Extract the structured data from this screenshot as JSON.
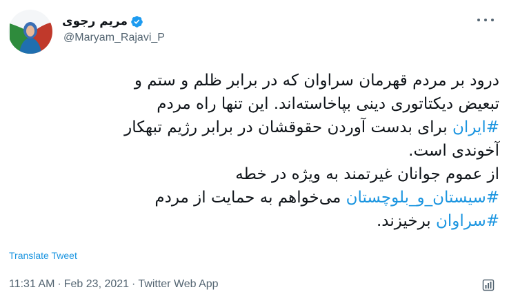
{
  "user": {
    "display_name": "مریم رجوی",
    "handle": "@Maryam_Rajavi_P",
    "verified_icon": "verified-badge-icon",
    "avatar_icon": "avatar"
  },
  "tweet": {
    "lines": [
      [
        {
          "text": "درود بر مردم قهرمان سراوان که در برابر ظلم و ستم و",
          "type": "text"
        }
      ],
      [
        {
          "text": "تبعیض دیکتاتوری دینی بپاخاسته‌اند. این تنها راه مردم",
          "type": "text"
        }
      ],
      [
        {
          "text": "#ایران",
          "type": "hashtag"
        },
        {
          "text": " برای بدست آوردن حقوقشان در برابر رژیم تبهکار",
          "type": "text"
        }
      ],
      [
        {
          "text": "آخوندی است.",
          "type": "text"
        }
      ],
      [
        {
          "text": "از عموم جوانان غیرتمند به ویژه در خطه",
          "type": "text"
        }
      ],
      [
        {
          "text": "#سیستان_و_بلوچستان",
          "type": "hashtag"
        },
        {
          "text": " می‌خواهم به حمایت از مردم",
          "type": "text"
        }
      ],
      [
        {
          "text": "#سراوان",
          "type": "hashtag"
        },
        {
          "text": " برخیزند.",
          "type": "text"
        }
      ]
    ]
  },
  "translate_label": "Translate Tweet",
  "meta": {
    "time": "11:31 AM",
    "separator": "·",
    "date": "Feb 23, 2021",
    "source": "Twitter Web App"
  },
  "icons": {
    "more": "more-options-icon",
    "stats": "tweet-analytics-icon"
  },
  "colors": {
    "link": "#1b95e0",
    "secondary_text": "#536471",
    "primary_text": "#0f1419",
    "verified": "#1d9bf0"
  }
}
